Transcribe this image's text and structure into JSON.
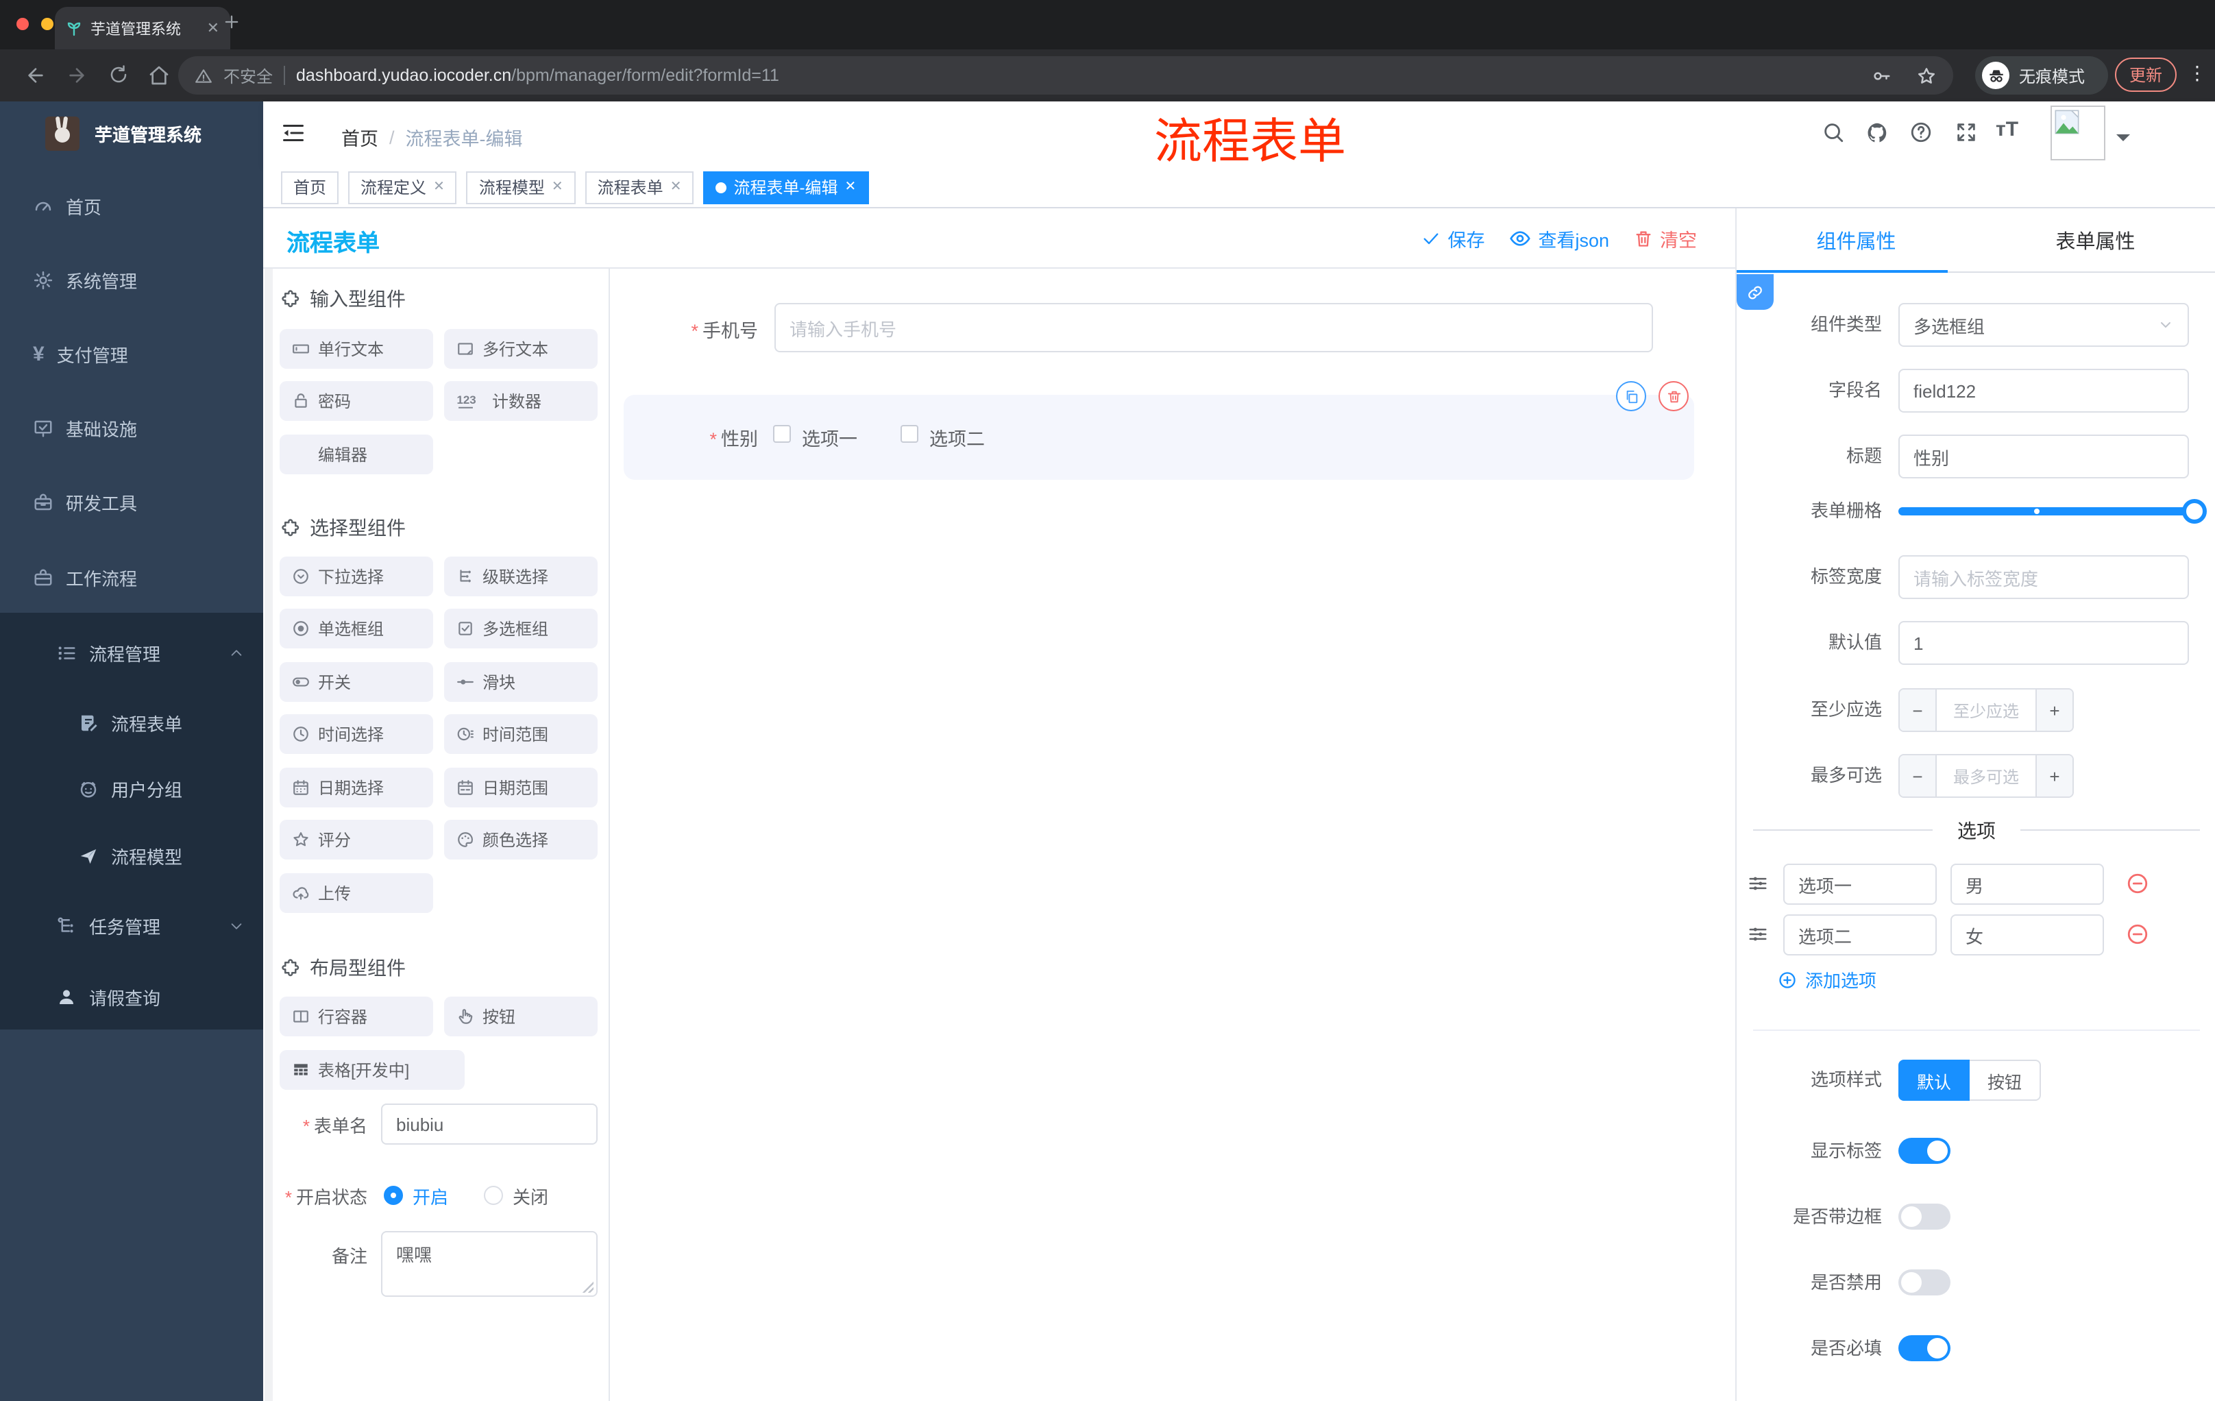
{
  "browser": {
    "tab_title": "芋道管理系统",
    "security_label": "不安全",
    "url_domain": "dashboard.yudao.iocoder.cn",
    "url_path": "/bpm/manager/form/edit?formId=11",
    "incognito_label": "无痕模式",
    "update_label": "更新"
  },
  "annotation": {
    "text": "流程表单",
    "color": "#ff2e00"
  },
  "sidebar": {
    "logo_title": "芋道管理系统",
    "items": [
      {
        "label": "首页"
      },
      {
        "label": "系统管理"
      },
      {
        "label": "支付管理"
      },
      {
        "label": "基础设施"
      },
      {
        "label": "研发工具"
      },
      {
        "label": "工作流程"
      }
    ],
    "submenu": {
      "group": "流程管理",
      "children": [
        {
          "label": "流程表单"
        },
        {
          "label": "用户分组"
        },
        {
          "label": "流程模型"
        }
      ],
      "siblings": [
        {
          "label": "任务管理"
        },
        {
          "label": "请假查询"
        }
      ]
    }
  },
  "header": {
    "breadcrumb_home": "首页",
    "breadcrumb_current": "流程表单-编辑"
  },
  "tags_view": {
    "tabs": [
      {
        "label": "首页"
      },
      {
        "label": "流程定义"
      },
      {
        "label": "流程模型"
      },
      {
        "label": "流程表单"
      },
      {
        "label": "流程表单-编辑"
      }
    ]
  },
  "designer": {
    "title": "流程表单",
    "save_label": "保存",
    "view_json_label": "查看json",
    "clear_label": "清空"
  },
  "components_panel": {
    "sections": [
      {
        "title": "输入型组件",
        "items": [
          {
            "label": "单行文本"
          },
          {
            "label": "多行文本"
          },
          {
            "label": "密码"
          },
          {
            "label": "计数器"
          },
          {
            "label": "编辑器"
          }
        ]
      },
      {
        "title": "选择型组件",
        "items": [
          {
            "label": "下拉选择"
          },
          {
            "label": "级联选择"
          },
          {
            "label": "单选框组"
          },
          {
            "label": "多选框组"
          },
          {
            "label": "开关"
          },
          {
            "label": "滑块"
          },
          {
            "label": "时间选择"
          },
          {
            "label": "时间范围"
          },
          {
            "label": "日期选择"
          },
          {
            "label": "日期范围"
          },
          {
            "label": "评分"
          },
          {
            "label": "颜色选择"
          },
          {
            "label": "上传"
          }
        ]
      },
      {
        "title": "布局型组件",
        "items": [
          {
            "label": "行容器"
          },
          {
            "label": "按钮"
          },
          {
            "label": "表格[开发中]"
          }
        ]
      }
    ],
    "form": {
      "name_label": "表单名",
      "name_value": "biubiu",
      "status_label": "开启状态",
      "status_on": "开启",
      "status_off": "关闭",
      "remark_label": "备注",
      "remark_value": "嘿嘿"
    }
  },
  "canvas": {
    "phone": {
      "label": "手机号",
      "placeholder": "请输入手机号"
    },
    "gender": {
      "label": "性别",
      "option1": "选项一",
      "option2": "选项二"
    }
  },
  "props": {
    "tab_component": "组件属性",
    "tab_form": "表单属性",
    "type_label": "组件类型",
    "type_value": "多选框组",
    "field_label": "字段名",
    "field_value": "field122",
    "title_label": "标题",
    "title_value": "性别",
    "grid_label": "表单栅格",
    "label_width_label": "标签宽度",
    "label_width_placeholder": "请输入标签宽度",
    "default_label": "默认值",
    "default_value": "1",
    "min_label": "至少应选",
    "min_placeholder": "至少应选",
    "max_label": "最多可选",
    "max_placeholder": "最多可选",
    "options_divider": "选项",
    "options": [
      {
        "label": "选项一",
        "value": "男"
      },
      {
        "label": "选项二",
        "value": "女"
      }
    ],
    "add_option": "添加选项",
    "style_label": "选项样式",
    "style_default": "默认",
    "style_button": "按钮",
    "show_label": "显示标签",
    "border_label": "是否带边框",
    "disabled_label": "是否禁用",
    "required_label": "是否必填"
  }
}
